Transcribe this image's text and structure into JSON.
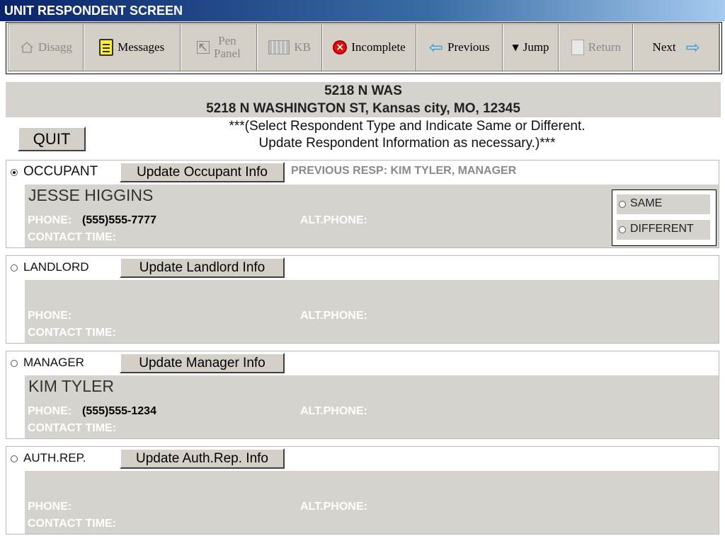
{
  "window": {
    "title": "UNIT RESPONDENT SCREEN"
  },
  "toolbar": {
    "disagg": {
      "label": "Disagg",
      "icon": "house-icon"
    },
    "messages": {
      "label": "Messages",
      "icon": "notes-icon"
    },
    "pen_panel": {
      "line1": "Pen",
      "line2": "Panel",
      "icon": "pen-icon"
    },
    "kb": {
      "label": "KB",
      "icon": "keyboard-icon"
    },
    "incomplete": {
      "label": "Incomplete",
      "icon": "red-x-icon"
    },
    "previous": {
      "label": "Previous",
      "icon": "left-arrow-icon"
    },
    "jump": {
      "label": "Jump",
      "icon": "triangle-down-icon"
    },
    "return": {
      "label": "Return",
      "icon": "return-icon"
    },
    "next": {
      "label": "Next",
      "icon": "right-arrow-icon"
    }
  },
  "address": {
    "short": "5218 N WAS",
    "full": "5218 N WASHINGTON ST, Kansas city, MO, 12345"
  },
  "quit_label": "QUIT",
  "instructions": {
    "line1": "***(Select Respondent Type and Indicate Same or Different.",
    "line2": "Update Respondent Information as necessary.)***"
  },
  "field_labels": {
    "phone": "PHONE:",
    "alt_phone": "ALT.PHONE:",
    "contact_time": "CONTACT TIME:"
  },
  "sections": {
    "occupant": {
      "label": "OCCUPANT",
      "selected": true,
      "button": "Update Occupant Info",
      "previous_resp": "PREVIOUS RESP: KIM TYLER, MANAGER",
      "name": "JESSE HIGGINS",
      "phone": "(555)555-7777"
    },
    "landlord": {
      "label": "LANDLORD",
      "selected": false,
      "button": "Update Landlord Info",
      "name": "",
      "phone": ""
    },
    "manager": {
      "label": "MANAGER",
      "selected": false,
      "button": "Update Manager Info",
      "name": "KIM TYLER",
      "phone": "(555)555-1234"
    },
    "auth_rep": {
      "label": "AUTH.REP.",
      "selected": false,
      "button": "Update Auth.Rep. Info",
      "name": "",
      "phone": ""
    }
  },
  "same_different": {
    "same": "SAME",
    "different": "DIFFERENT"
  },
  "colors": {
    "titlebar_start": "#0a246a",
    "titlebar_end": "#a6caf0",
    "panel_gray": "#d6d3ce",
    "button_face": "#d4d0c8",
    "arrow_blue": "#2a9de0",
    "incomplete_red": "#e01010"
  }
}
